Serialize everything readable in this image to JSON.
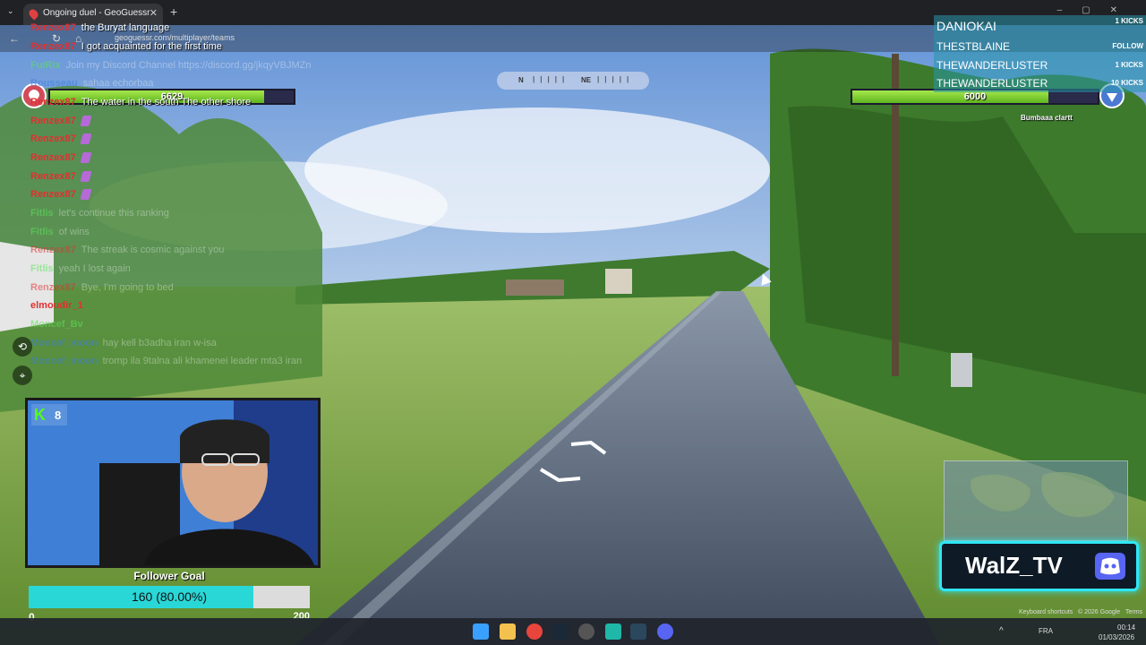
{
  "browser": {
    "tab_title": "Ongoing duel - GeoGuessr",
    "url": "geoguessr.com/multiplayer/teams"
  },
  "chat": [
    {
      "user": "Renzex87",
      "text": "the Buryat language",
      "color": "#e03030",
      "faint": false
    },
    {
      "user": "Renzex87",
      "text": "I got acquainted for the first time",
      "color": "#e03030",
      "faint": false
    },
    {
      "user": "FuiRix",
      "text": "Join my Discord Channel https://discord.gg/jkqyVBJMZn",
      "color": "#5be35b",
      "faint": true
    },
    {
      "user": "Rousseau",
      "text": "sahaa echorbaa",
      "color": "#3a7be0",
      "faint": true
    },
    {
      "user": "Renzex87",
      "text": "The water in the south The other shore",
      "color": "#e03030",
      "faint": false
    },
    {
      "user": "Renzex87",
      "text": "",
      "color": "#e03030",
      "faint": false,
      "emote": true
    },
    {
      "user": "Renzex87",
      "text": "",
      "color": "#e03030",
      "faint": false,
      "emote": true
    },
    {
      "user": "Renzex87",
      "text": "",
      "color": "#e03030",
      "faint": false,
      "emote": true
    },
    {
      "user": "Renzex87",
      "text": "",
      "color": "#e03030",
      "faint": false,
      "emote": true
    },
    {
      "user": "Renzex87",
      "text": "",
      "color": "#e03030",
      "faint": false,
      "emote": true
    },
    {
      "user": "Fitlis",
      "text": "let's continue this ranking",
      "color": "#5be35b",
      "faint": true
    },
    {
      "user": "Fitlis",
      "text": "of wins",
      "color": "#5be35b",
      "faint": true
    },
    {
      "user": "Renzex87",
      "text": "The streak is cosmic against you",
      "color": "#e03030",
      "faint": true
    },
    {
      "user": "Fitlis",
      "text": "yeah I lost again",
      "color": "#5be35b",
      "faint": true
    },
    {
      "user": "Renzex87",
      "text": "Bye, I'm going to bed",
      "color": "#e03030",
      "faint": true
    },
    {
      "user": "elmoudir_1",
      "text": "",
      "color": "#e03030",
      "faint": false
    },
    {
      "user": "Moncef_Bv",
      "text": "",
      "color": "#5be35b",
      "faint": true
    },
    {
      "user": "Moncef_moon",
      "text": "hay kell b3adha iran w-isa",
      "color": "#3a7be0",
      "faint": true
    },
    {
      "user": "Moncef_moon",
      "text": "tromp ila 9talna ali khamenei leader mta3 iran",
      "color": "#3a7be0",
      "faint": true
    }
  ],
  "game": {
    "left_health": "6629",
    "left_health_fraction": 0.88,
    "right_health": "6000",
    "right_health_fraction": 0.8,
    "right_name": "Bumbaaa clartt",
    "compass": [
      "N",
      "NE"
    ]
  },
  "team": {
    "title": "DANIOKAI",
    "title_kicks": "1 KICKS",
    "rows": [
      {
        "name": "THESTBLAINE",
        "kicks": "FOLLOW"
      },
      {
        "name": "THEWANDERLUSTER",
        "kicks": "1 KICKS"
      },
      {
        "name": "THEWANDERLUSTER",
        "kicks": "10 KICKS"
      }
    ]
  },
  "webcam": {
    "badge_letter": "K",
    "badge_count": "8"
  },
  "follower_goal": {
    "title": "Follower Goal",
    "label": "160 (80.00%)",
    "fraction": 0.8,
    "min": "0",
    "max": "200"
  },
  "brand": {
    "name": "WalZ_TV"
  },
  "map_footer": {
    "keyboard": "Keyboard shortcuts",
    "copyright": "© 2026 Google",
    "terms": "Terms"
  },
  "tray": {
    "lang": "FRA",
    "time": "00:14",
    "date": "01/03/2026"
  },
  "colors": {
    "health_green": "#7fd12f",
    "goal_fill": "#2ad7d7",
    "brand_glow": "#2fe6f5"
  }
}
